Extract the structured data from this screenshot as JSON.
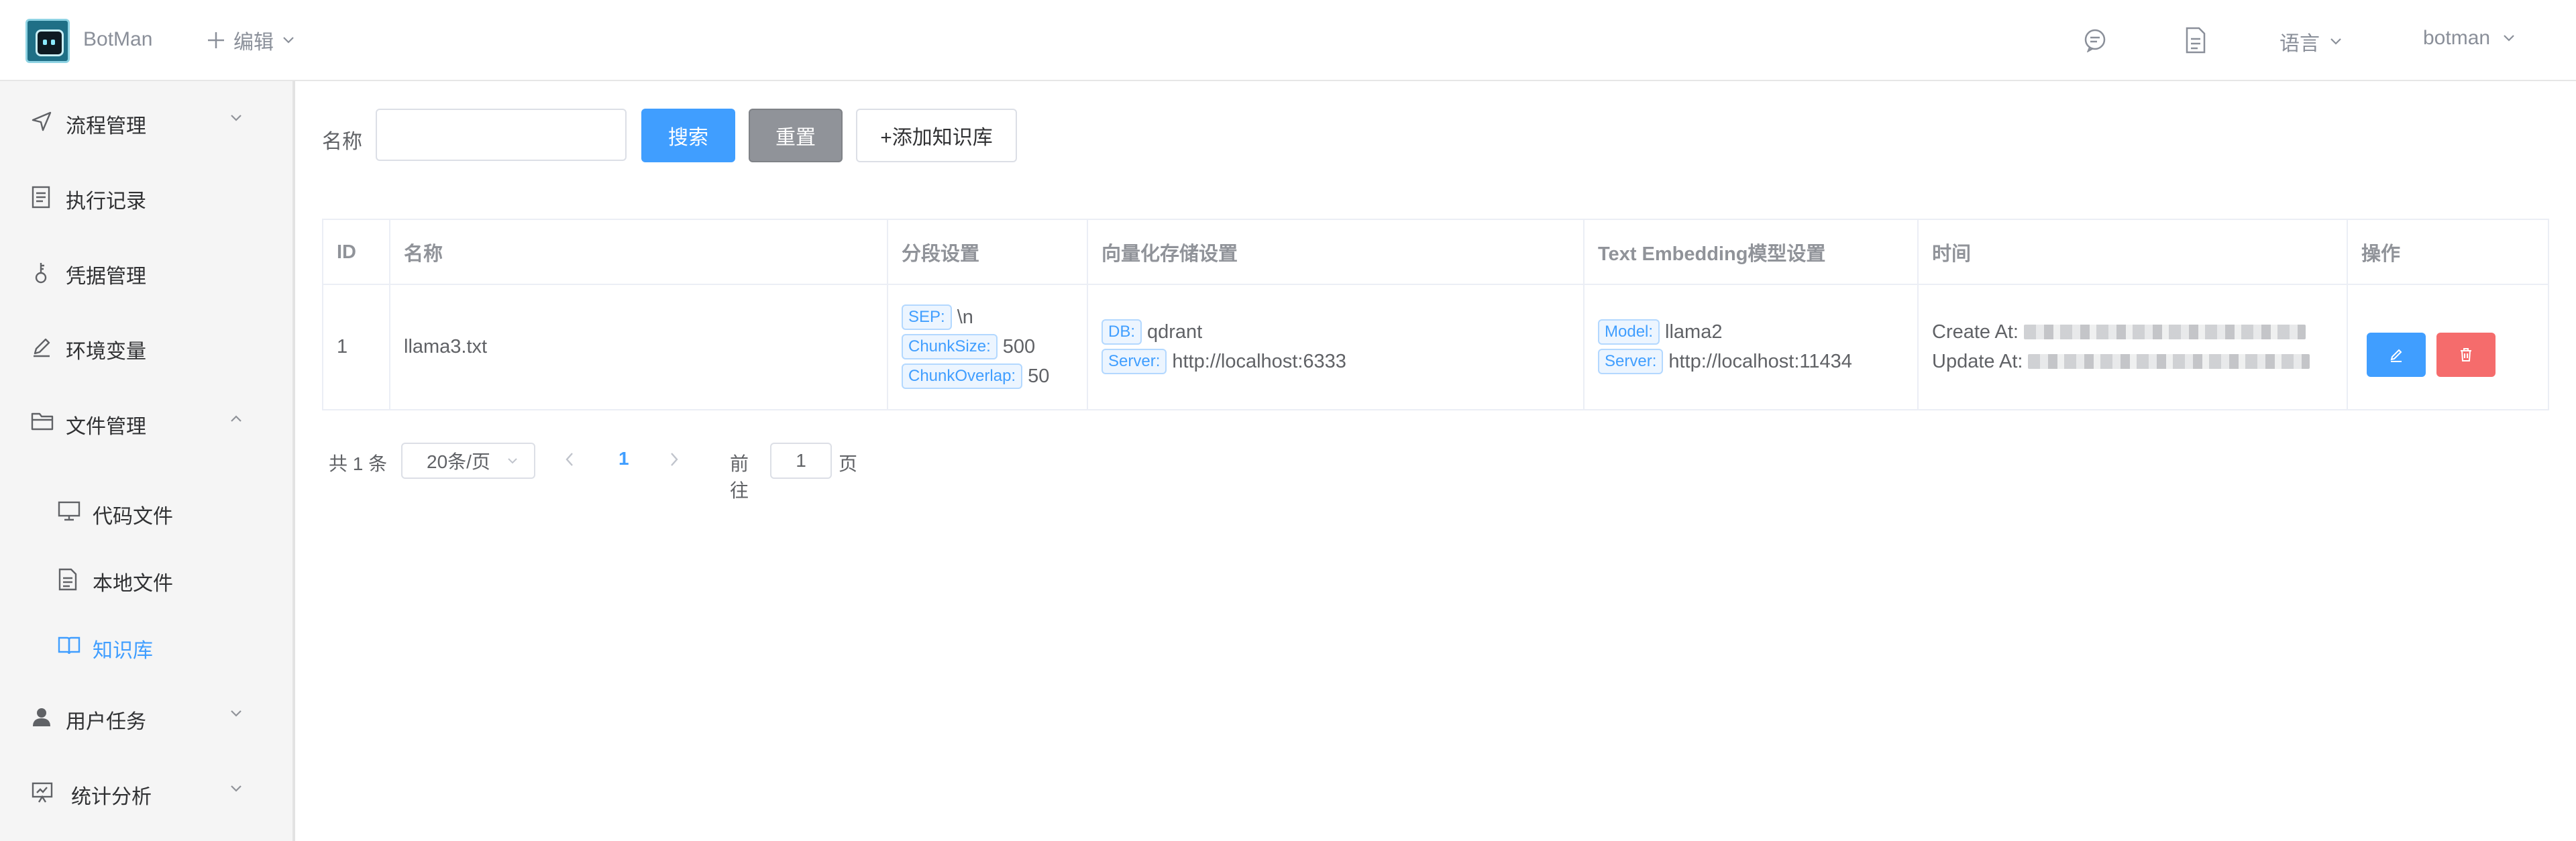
{
  "header": {
    "app_name": "BotMan",
    "edit_label": "编辑",
    "language_label": "语言",
    "user_name": "botman"
  },
  "sidebar": {
    "items": [
      {
        "label": "流程管理",
        "icon": "navigation-icon",
        "expanded": false
      },
      {
        "label": "执行记录",
        "icon": "document-list-icon"
      },
      {
        "label": "凭据管理",
        "icon": "key-icon"
      },
      {
        "label": "环境变量",
        "icon": "edit-pen-icon"
      },
      {
        "label": "文件管理",
        "icon": "folder-open-icon",
        "expanded": true
      },
      {
        "label": "代码文件",
        "icon": "monitor-icon",
        "sub": true
      },
      {
        "label": "本地文件",
        "icon": "document-icon",
        "sub": true
      },
      {
        "label": "知识库",
        "icon": "book-icon",
        "sub": true,
        "active": true
      },
      {
        "label": "用户任务",
        "icon": "user-icon",
        "expanded": false
      },
      {
        "label": "统计分析",
        "icon": "presentation-icon",
        "expanded": false
      }
    ]
  },
  "search": {
    "name_label": "名称",
    "name_value": "",
    "search_button": "搜索",
    "reset_button": "重置",
    "add_button": "+添加知识库"
  },
  "table": {
    "columns": [
      "ID",
      "名称",
      "分段设置",
      "向量化存储设置",
      "Text Embedding模型设置",
      "时间",
      "操作"
    ],
    "rows": [
      {
        "id": "1",
        "name": "llama3.txt",
        "segment": {
          "sep_tag": "SEP:",
          "sep_value": "\\n",
          "size_tag": "ChunkSize:",
          "size_value": "500",
          "overlap_tag": "ChunkOverlap:",
          "overlap_value": "50"
        },
        "vector": {
          "db_tag": "DB:",
          "db_value": "qdrant",
          "server_tag": "Server:",
          "server_value": "http://localhost:6333"
        },
        "embedding": {
          "model_tag": "Model:",
          "model_value": "llama2",
          "server_tag": "Server:",
          "server_value": "http://localhost:11434"
        },
        "time": {
          "create_label": "Create At:",
          "update_label": "Update At:"
        }
      }
    ]
  },
  "pagination": {
    "total": "共 1 条",
    "page_size": "20条/页",
    "current_page": "1",
    "goto_label": "前往",
    "goto_value": "1",
    "goto_suffix": "页"
  },
  "colors": {
    "primary": "#409eff",
    "danger": "#f56c6c",
    "info": "#909399",
    "sidebar_bg": "#f5f5f5"
  }
}
